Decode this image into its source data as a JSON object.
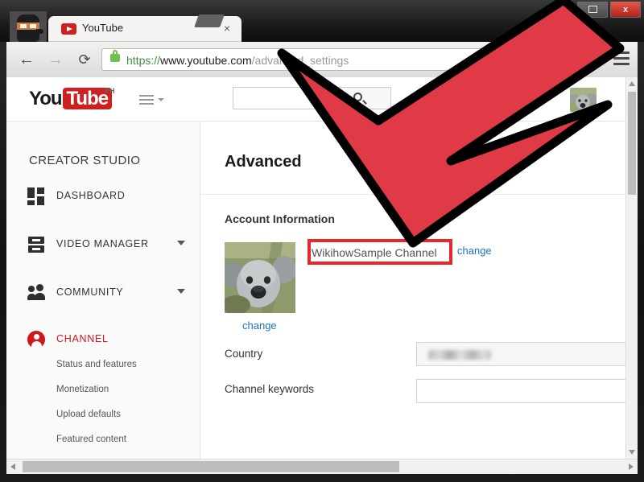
{
  "window": {
    "controls": {
      "restore_label": "",
      "close_label": "x"
    },
    "profile_icon": "ninja-avatar-icon"
  },
  "browser": {
    "tab": {
      "title": "YouTube",
      "close_label": "×",
      "favicon": "youtube-favicon"
    },
    "nav": {
      "back_label": "←",
      "forward_label": "→",
      "reload_label": "⟳"
    },
    "omnibox": {
      "security_icon": "lock-icon",
      "url_scheme": "https://",
      "url_host": "www.youtube.com",
      "url_path": "/advanced_settings",
      "full_url": "https://www.youtube.com/advanced_settings"
    },
    "star_label": "☆",
    "menu_icon": "hamburger-menu-icon"
  },
  "youtube": {
    "logo": {
      "you": "You",
      "tube": "Tube",
      "country_code": "PH"
    },
    "guide_button": "hamburger-guide-icon",
    "search": {
      "value": "",
      "placeholder": "",
      "button_icon": "search-icon"
    },
    "avatar": "koala-avatar"
  },
  "sidebar": {
    "title": "CREATOR STUDIO",
    "items": [
      {
        "label": "DASHBOARD",
        "icon": "dashboard-icon",
        "expandable": false,
        "active": false
      },
      {
        "label": "VIDEO MANAGER",
        "icon": "video-manager-icon",
        "expandable": true,
        "active": false
      },
      {
        "label": "COMMUNITY",
        "icon": "community-icon",
        "expandable": true,
        "active": false
      },
      {
        "label": "CHANNEL",
        "icon": "channel-person-icon",
        "expandable": false,
        "active": true
      }
    ],
    "sub_items": [
      {
        "label": "Status and features"
      },
      {
        "label": "Monetization"
      },
      {
        "label": "Upload defaults"
      },
      {
        "label": "Featured content"
      }
    ]
  },
  "main": {
    "page_title": "Advanced",
    "section_title": "Account Information",
    "channel": {
      "thumbnail": "koala-channel-thumbnail",
      "thumbnail_change_label": "change",
      "name_value": "WikihowSample Channel",
      "name_change_label": "change"
    },
    "fields": [
      {
        "label": "Country",
        "value": "",
        "redacted": true
      },
      {
        "label": "Channel keywords",
        "value": "",
        "redacted": false
      }
    ]
  },
  "annotation": {
    "highlight_color": "#e8262e",
    "arrow_fill": "#e03a47",
    "arrow_stroke": "#000000",
    "target": "channel-name-field"
  },
  "colors": {
    "youtube_red": "#cd201f",
    "link_blue": "#1a73c8",
    "accent_red": "#cc181e",
    "lock_green": "#6fc24c"
  }
}
